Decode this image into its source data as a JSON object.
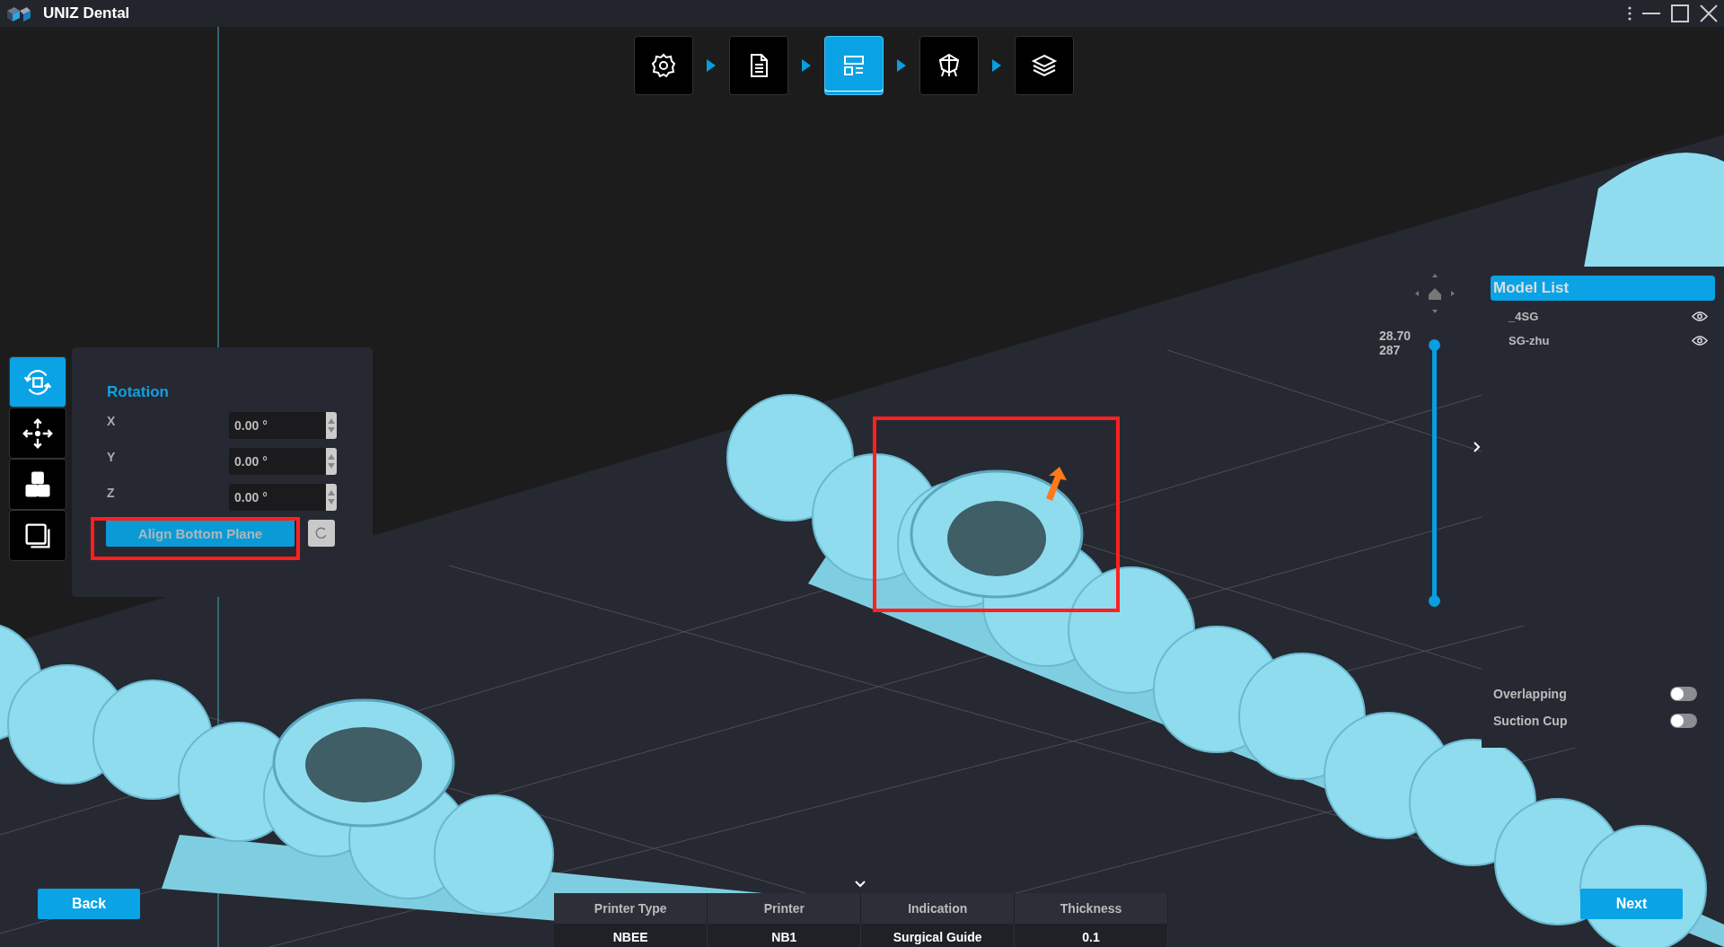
{
  "window": {
    "title": "UNIZ Dental"
  },
  "steps": [
    {
      "kind": "settings",
      "selected": false
    },
    {
      "kind": "document",
      "selected": false
    },
    {
      "kind": "layout",
      "selected": true
    },
    {
      "kind": "support",
      "selected": false
    },
    {
      "kind": "layers",
      "selected": false
    }
  ],
  "tools": [
    {
      "kind": "rotate",
      "selected": true
    },
    {
      "kind": "move",
      "selected": false
    },
    {
      "kind": "arrange",
      "selected": false
    },
    {
      "kind": "duplicate",
      "selected": false
    }
  ],
  "rotation_panel": {
    "title": "Rotation",
    "fields": [
      {
        "label": "X",
        "value": "0.00 °"
      },
      {
        "label": "Y",
        "value": "0.00 °"
      },
      {
        "label": "Z",
        "value": "0.00 °"
      }
    ],
    "align_button": "Align Bottom Plane"
  },
  "annotations": {
    "align_button_boxed": true,
    "model_boxed": true
  },
  "height_slider": {
    "top_value": "28.70",
    "top_layer": "287",
    "level": 1
  },
  "model_list": {
    "title": "Model List",
    "items": [
      {
        "name": "_4SG",
        "visible": true
      },
      {
        "name": "SG-zhu",
        "visible": true
      }
    ]
  },
  "options": [
    {
      "label": "Overlapping",
      "on": false
    },
    {
      "label": "Suction Cup",
      "on": false
    }
  ],
  "job_table": {
    "columns": [
      "Printer Type",
      "Printer",
      "Indication",
      "Thickness"
    ],
    "rows": [
      [
        "NBEE",
        "NB1",
        "Surgical Guide",
        "0.1"
      ]
    ]
  },
  "nav": {
    "back": "Back",
    "next": "Next"
  }
}
